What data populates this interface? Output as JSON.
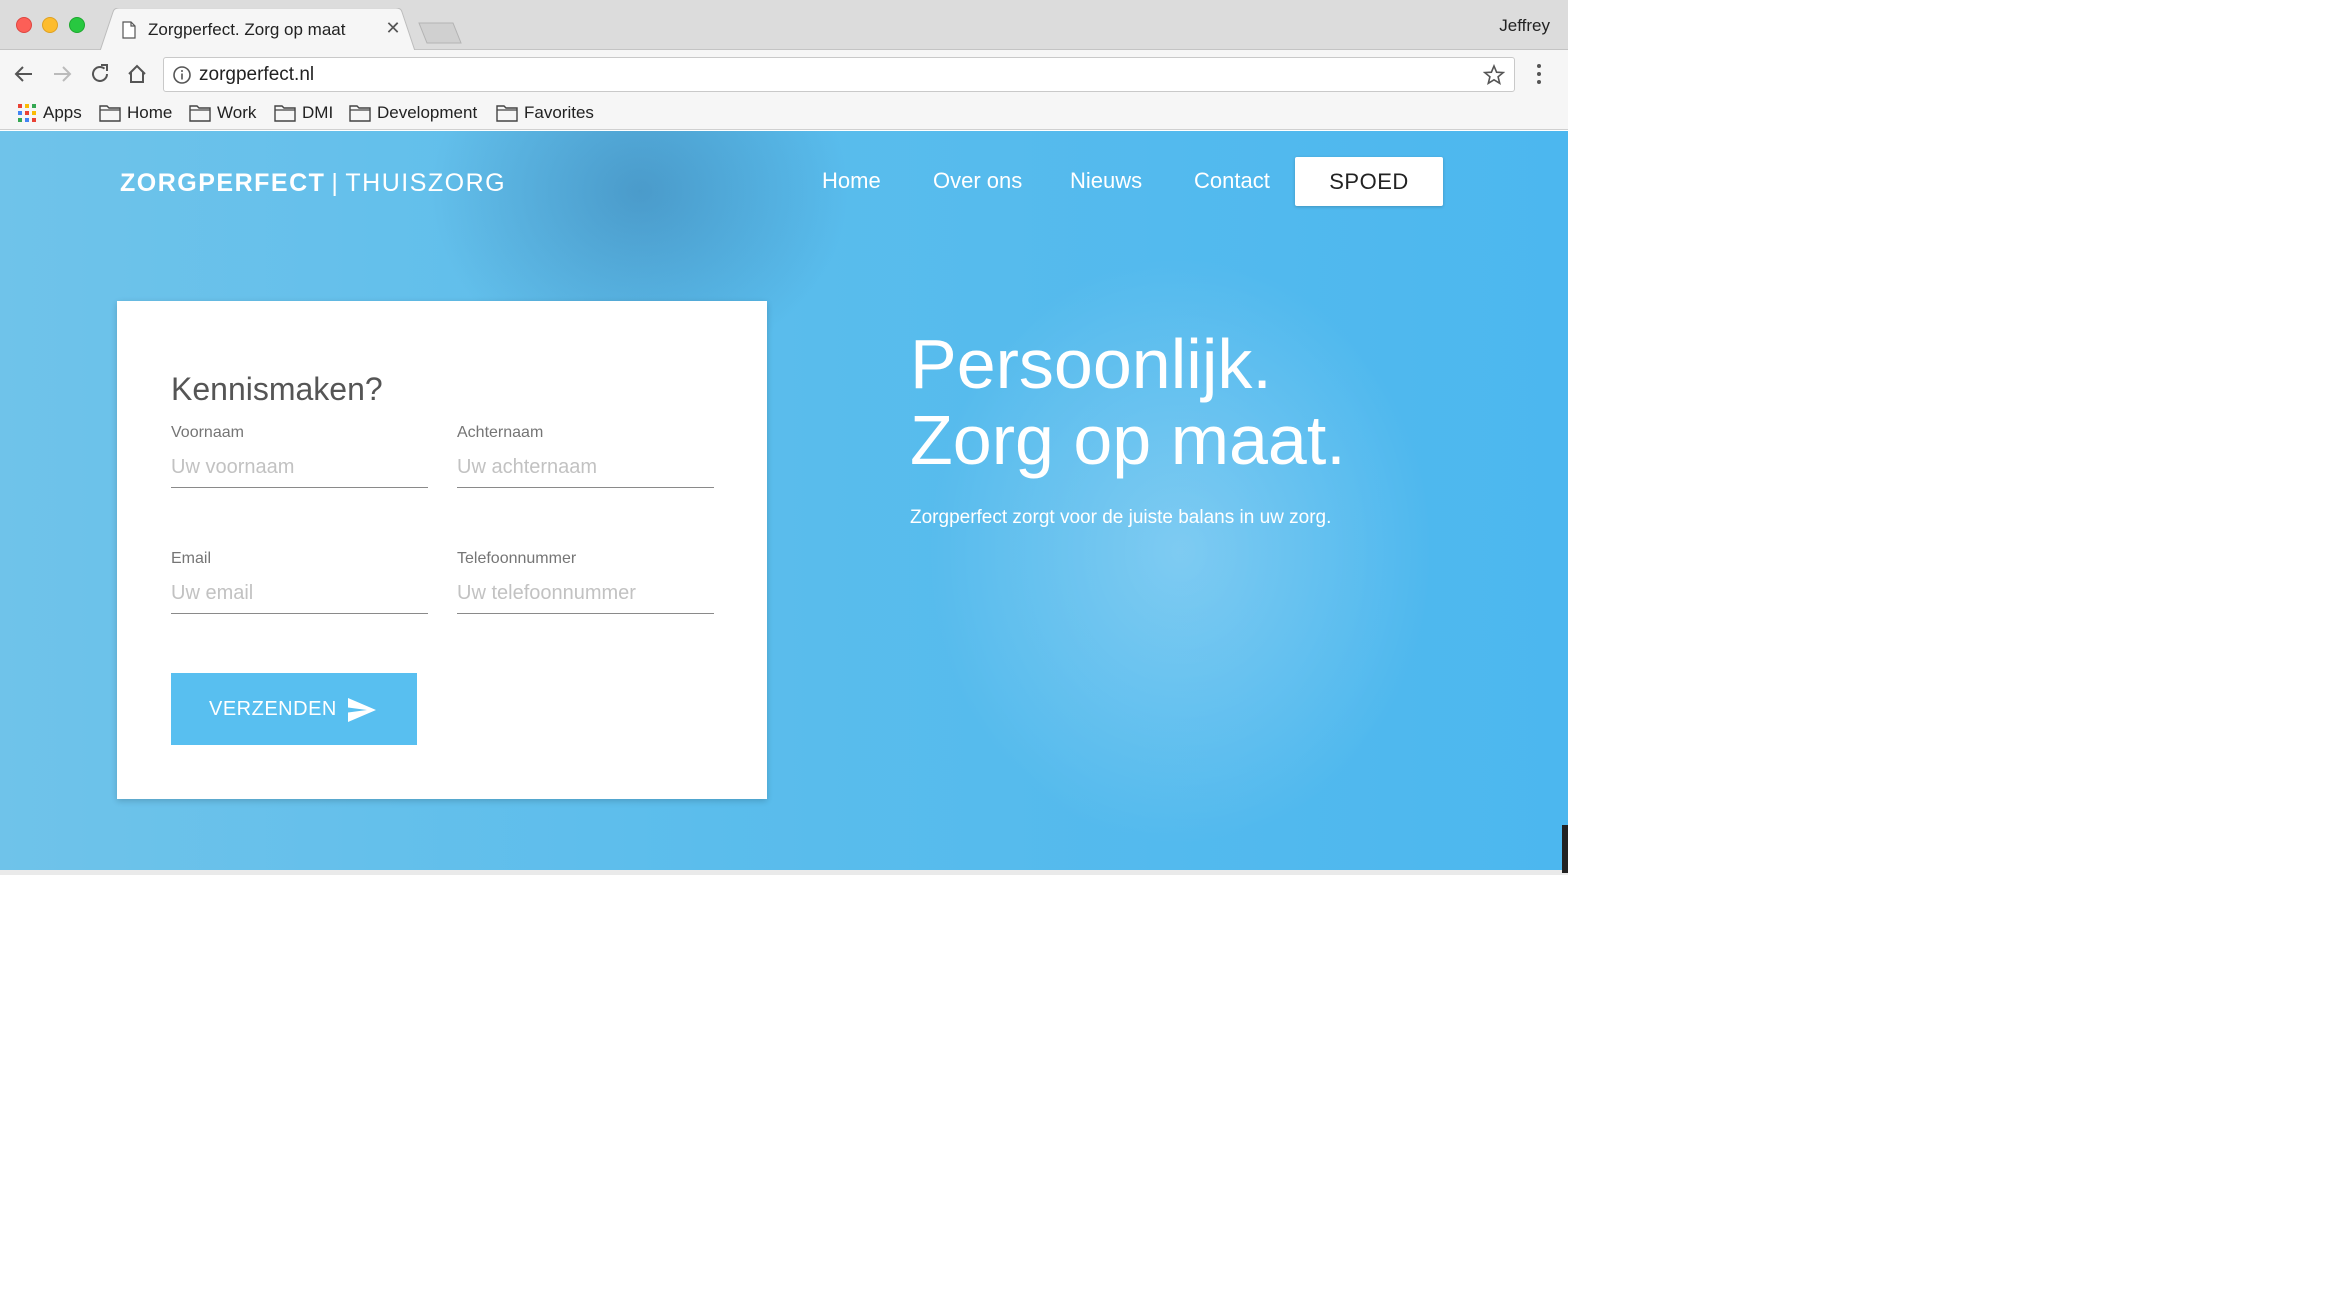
{
  "browser": {
    "tab_title": "Zorgperfect. Zorg op maat",
    "profile_name": "Jeffrey",
    "url": "zorgperfect.nl",
    "bookmarks": [
      "Apps",
      "Home",
      "Work",
      "DMI",
      "Development",
      "Favorites"
    ]
  },
  "site": {
    "brand_bold": "ZORGPERFECT",
    "brand_separator": "|",
    "brand_light": "THUISZORG",
    "nav": [
      "Home",
      "Over ons",
      "Nieuws",
      "Contact"
    ],
    "cta": "SPOED"
  },
  "form": {
    "title": "Kennismaken?",
    "fields": [
      {
        "label": "Voornaam",
        "placeholder": "Uw voornaam"
      },
      {
        "label": "Achternaam",
        "placeholder": "Uw achternaam"
      },
      {
        "label": "Email",
        "placeholder": "Uw email"
      },
      {
        "label": "Telefoonnummer",
        "placeholder": "Uw telefoonnummer"
      }
    ],
    "submit": "VERZENDEN"
  },
  "hero": {
    "line1": "Persoonlijk.",
    "line2": "Zorg op maat.",
    "subtitle": "Zorgperfect zorgt voor de juiste balans in uw zorg."
  }
}
